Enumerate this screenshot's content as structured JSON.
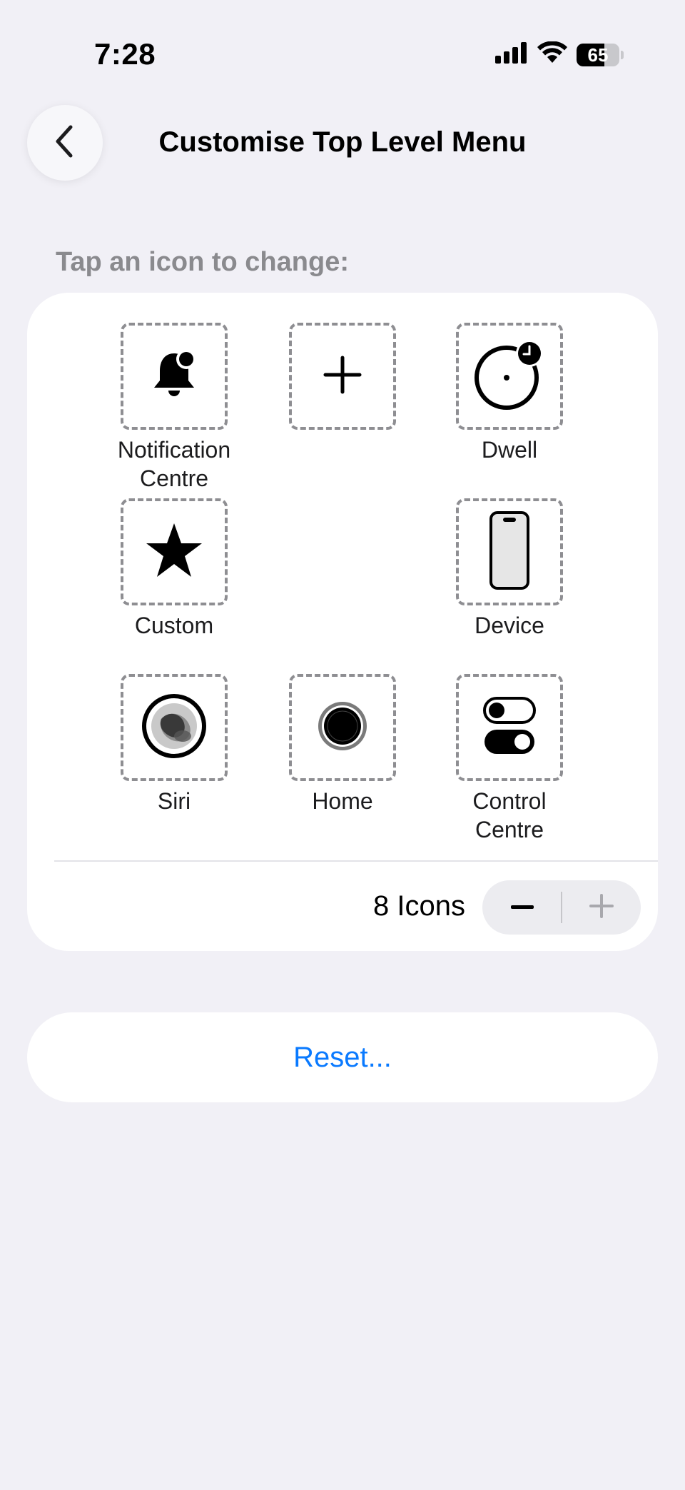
{
  "status_bar": {
    "time": "7:28",
    "battery_level": "65",
    "battery_fraction": 0.65,
    "signal_bars": 4
  },
  "nav": {
    "title": "Customise Top Level Menu",
    "back_icon": "chevron-left-icon"
  },
  "section_header": "Tap an icon to change:",
  "slots": [
    {
      "label": "Notification\nCentre",
      "icon": "bell-badge-icon"
    },
    {
      "label": "",
      "icon": "plus-icon"
    },
    {
      "label": "Dwell",
      "icon": "dwell-timer-icon"
    },
    {
      "label": "Custom",
      "icon": "star-icon"
    },
    {
      "label": "Device",
      "icon": "iphone-icon"
    },
    {
      "label": "Siri",
      "icon": "siri-icon"
    },
    {
      "label": "Home",
      "icon": "home-button-icon"
    },
    {
      "label": "Control\nCentre",
      "icon": "toggles-icon"
    }
  ],
  "icon_count": {
    "label": "8 Icons",
    "decrement_icon": "minus-icon",
    "increment_icon": "plus-icon"
  },
  "reset": {
    "label": "Reset..."
  },
  "colors": {
    "background": "#f1f0f6",
    "card": "#ffffff",
    "accent": "#0a7aff",
    "secondary_text": "#8a8a8e"
  }
}
